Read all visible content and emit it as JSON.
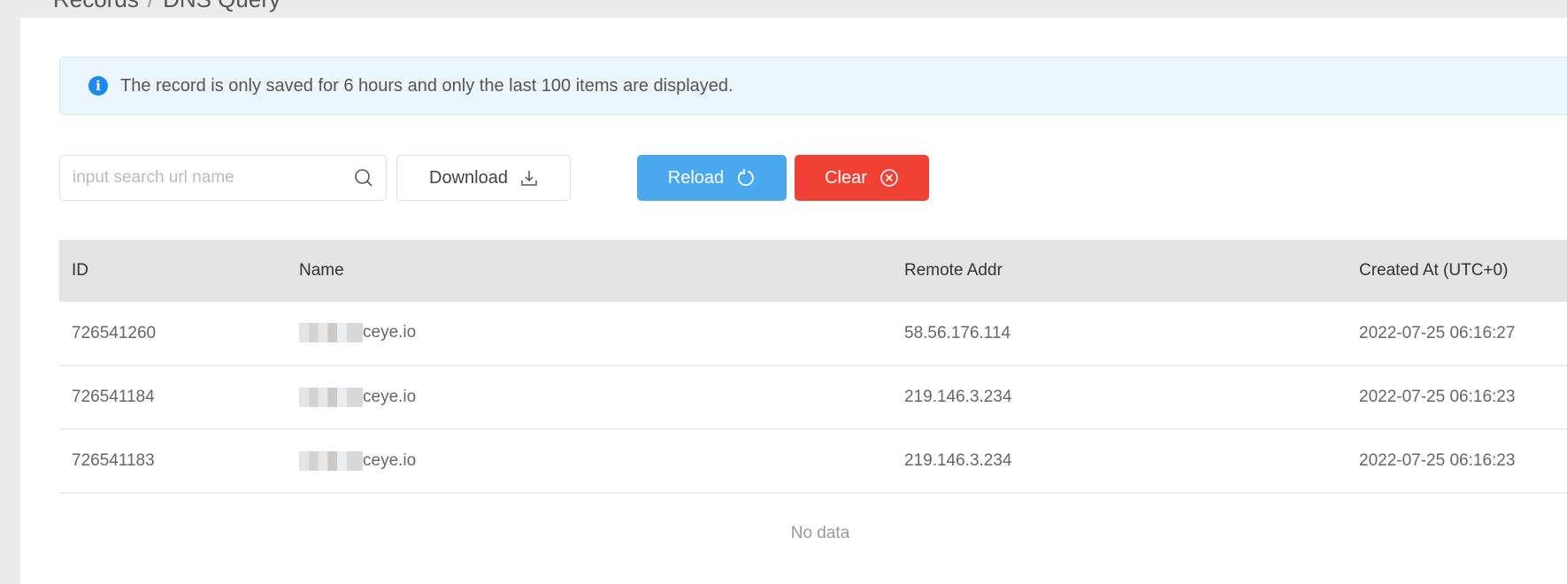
{
  "breadcrumb": [
    "Records",
    "DNS Query"
  ],
  "alert": {
    "icon": "info-icon",
    "text": "The record is only saved for 6 hours and only the last 100 items are displayed."
  },
  "toolbar": {
    "search_placeholder": "input search url name",
    "download": "Download",
    "reload": "Reload",
    "clear": "Clear"
  },
  "colors": {
    "reload": "#4aa8ee",
    "clear": "#f04134",
    "info": "#1e8ae8"
  },
  "table": {
    "headers": [
      "ID",
      "Name",
      "Remote Addr",
      "Created At (UTC+0)"
    ],
    "rows": [
      {
        "id": "726541260",
        "name": "ceye.io",
        "addr": "58.56.176.114",
        "created": "2022-07-25 06:16:27"
      },
      {
        "id": "726541184",
        "name": "ceye.io",
        "addr": "219.146.3.234",
        "created": "2022-07-25 06:16:23"
      },
      {
        "id": "726541183",
        "name": "ceye.io",
        "addr": "219.146.3.234",
        "created": "2022-07-25 06:16:23"
      }
    ],
    "empty": "No data"
  }
}
